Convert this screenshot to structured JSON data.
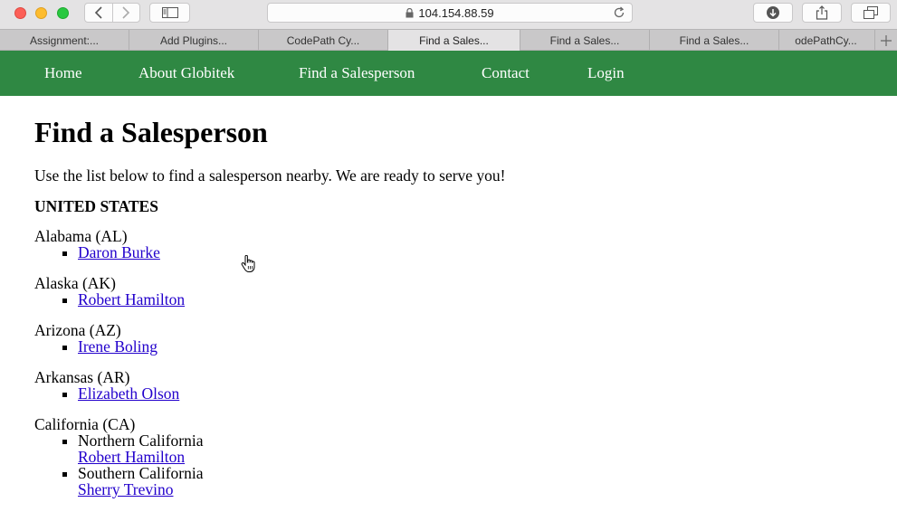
{
  "browser": {
    "url": "104.154.88.59",
    "tabs": [
      {
        "label": "Assignment:..."
      },
      {
        "label": "Add Plugins..."
      },
      {
        "label": "CodePath Cy..."
      },
      {
        "label": "Find a Sales...",
        "active": true
      },
      {
        "label": "Find a Sales..."
      },
      {
        "label": "Find a Sales..."
      },
      {
        "label": "odePathCy..."
      }
    ]
  },
  "nav": {
    "items": [
      {
        "label": "Home"
      },
      {
        "label": "About Globitek"
      },
      {
        "label": "Find a Salesperson"
      },
      {
        "label": "Contact"
      },
      {
        "label": "Login"
      }
    ]
  },
  "main": {
    "title": "Find a Salesperson",
    "intro": "Use the list below to find a salesperson nearby. We are ready to serve you!",
    "country": "UNITED STATES",
    "states": [
      {
        "name": "Alabama (AL)",
        "salespeople": [
          "Daron Burke"
        ]
      },
      {
        "name": "Alaska (AK)",
        "salespeople": [
          "Robert Hamilton"
        ]
      },
      {
        "name": "Arizona (AZ)",
        "salespeople": [
          "Irene Boling"
        ]
      },
      {
        "name": "Arkansas (AR)",
        "salespeople": [
          "Elizabeth Olson"
        ]
      },
      {
        "name": "California (CA)",
        "regions": [
          {
            "name": "Northern California",
            "salesperson": "Robert Hamilton"
          },
          {
            "name": "Southern California",
            "salesperson": "Sherry Trevino"
          }
        ]
      }
    ]
  },
  "colors": {
    "nav_bg": "#2f8843",
    "link": "#2200cc"
  }
}
